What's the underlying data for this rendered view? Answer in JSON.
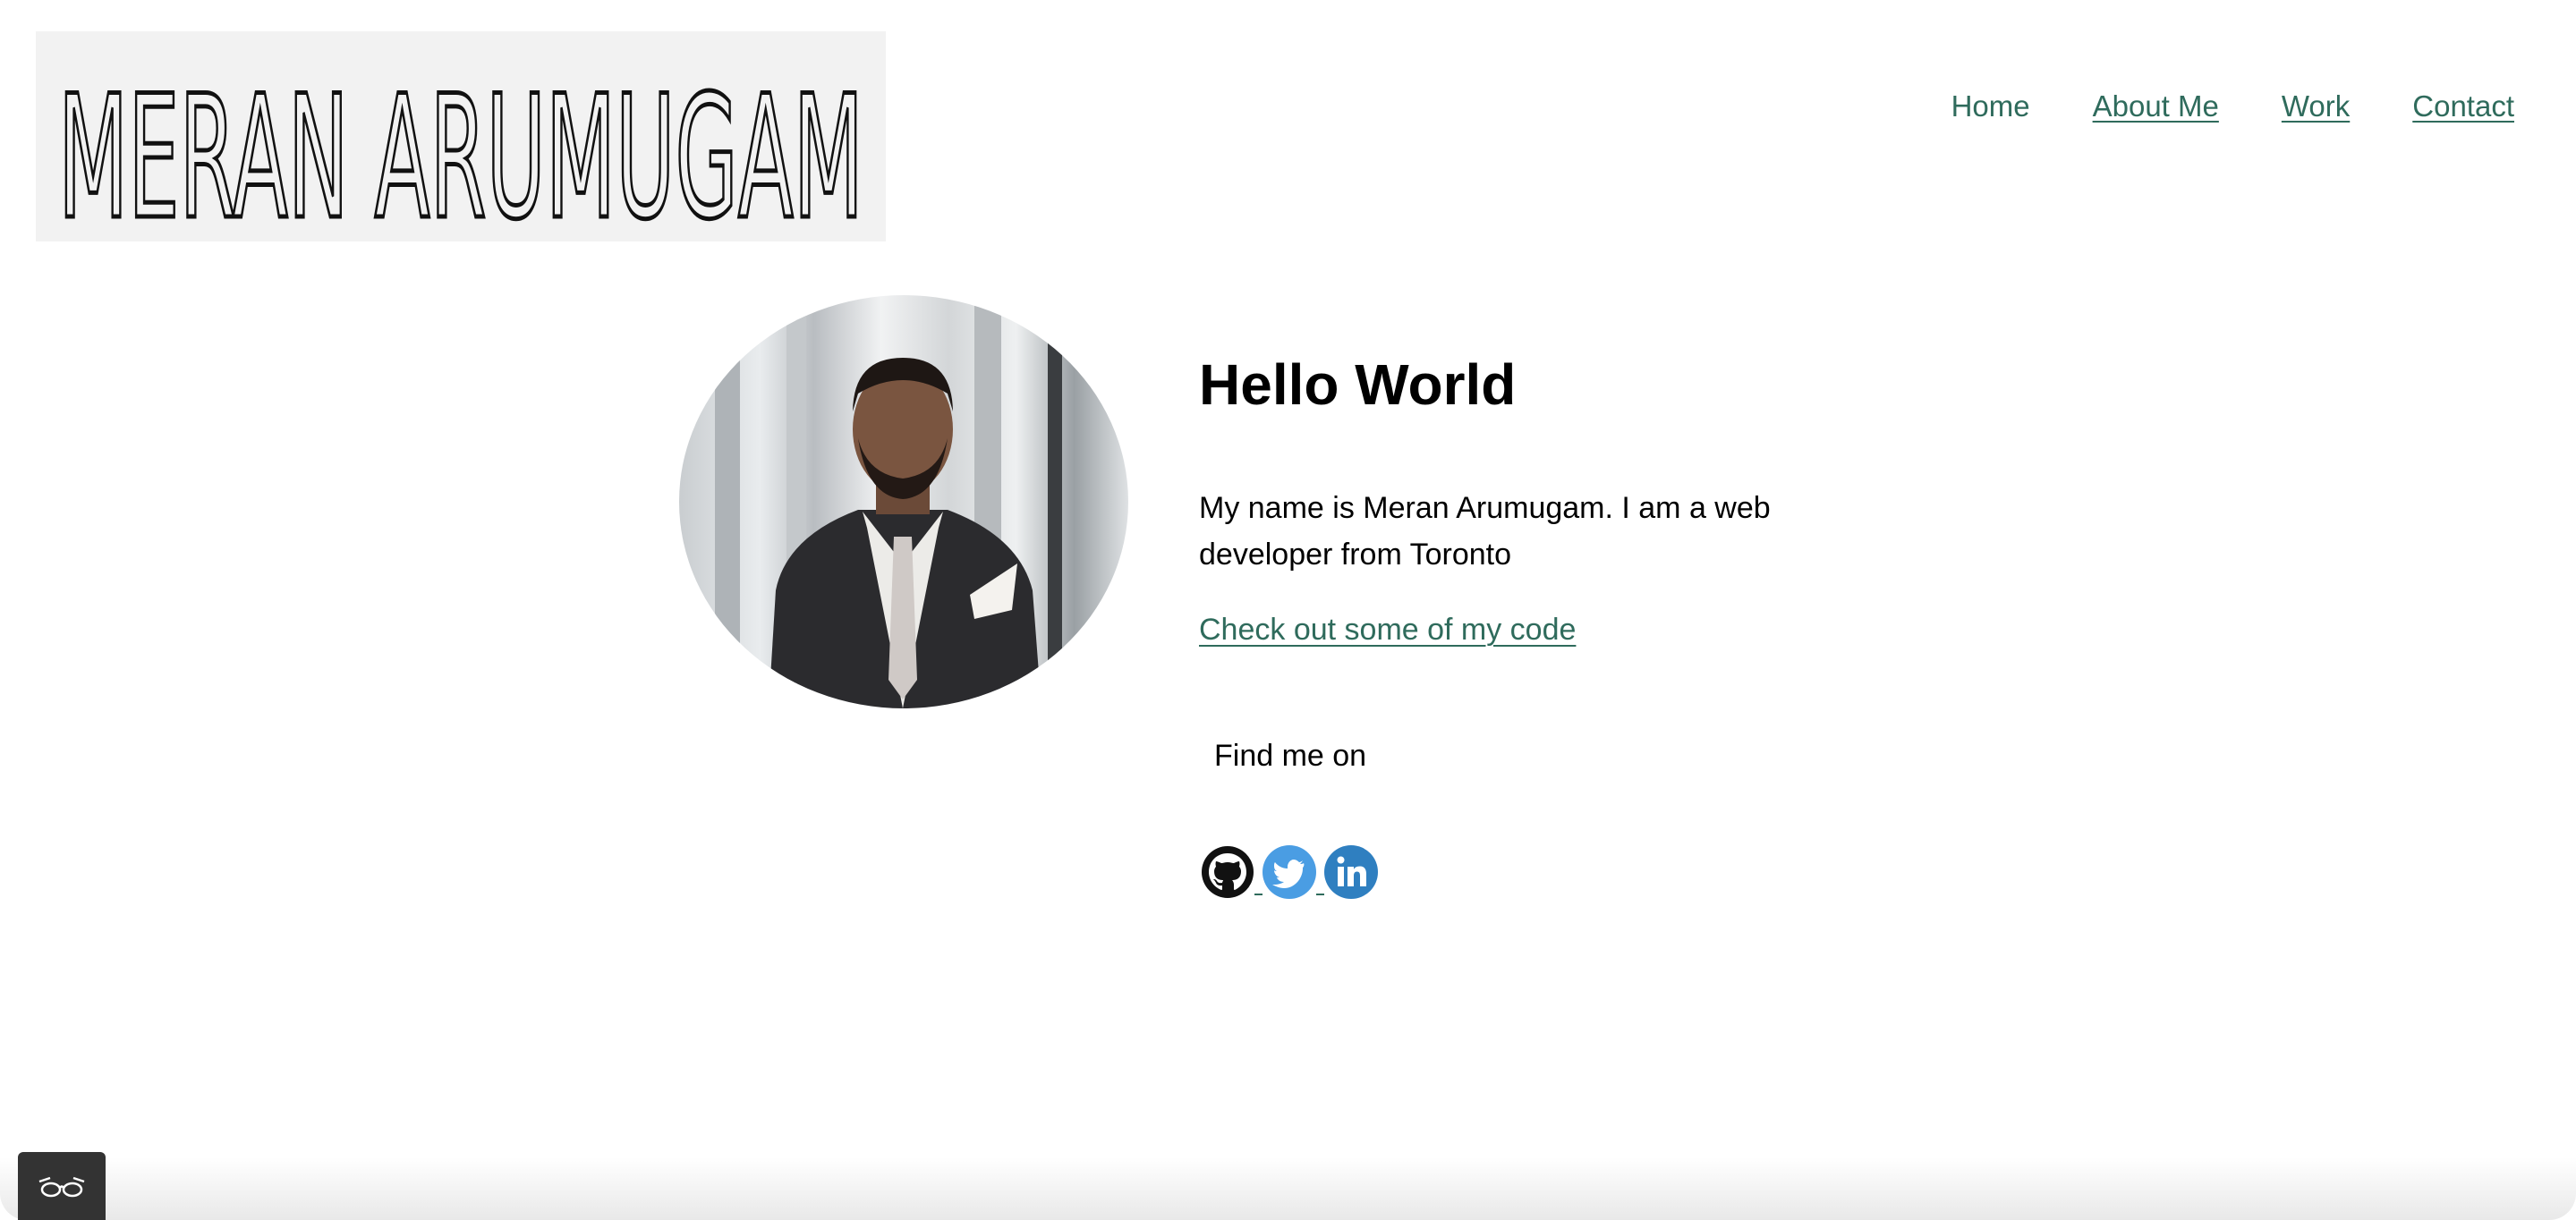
{
  "header": {
    "logo_text": "MERAN ARUMUGAM",
    "nav": [
      {
        "label": "Home"
      },
      {
        "label": "About Me"
      },
      {
        "label": "Work"
      },
      {
        "label": "Contact"
      }
    ]
  },
  "hero": {
    "title": "Hello World",
    "intro": "My name is Meran Arumugam. I am a web developer from Toronto",
    "code_link": "Check out some of my code",
    "find_me": "Find me on"
  },
  "social": [
    {
      "icon": "github-icon"
    },
    {
      "icon": "twitter-icon"
    },
    {
      "icon": "linkedin-icon"
    }
  ],
  "colors": {
    "link": "#2f6b5c",
    "twitter": "#4a9de3",
    "linkedin": "#2f7fc0",
    "widget": "#333333"
  }
}
